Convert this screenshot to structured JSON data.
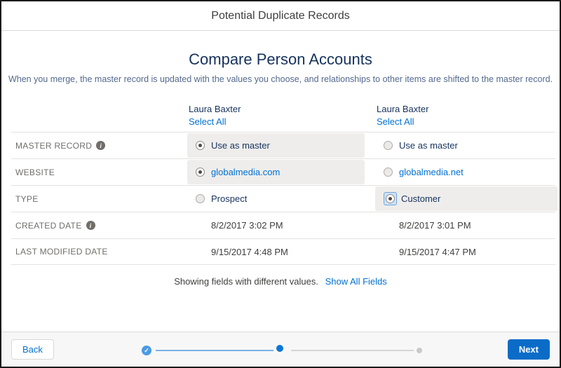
{
  "dialog": {
    "title": "Potential Duplicate Records"
  },
  "main": {
    "title": "Compare Person Accounts",
    "subtitle": "When you merge, the master record is updated with the values you choose, and relationships to other items are shifted to the master record.",
    "columns": [
      {
        "name": "Laura Baxter",
        "select_all": "Select All"
      },
      {
        "name": "Laura Baxter",
        "select_all": "Select All"
      }
    ],
    "rows": [
      {
        "label": "MASTER RECORD",
        "has_info_icon": true,
        "cells": [
          {
            "control": "radio",
            "checked": true,
            "highlighted": true,
            "text": "Use as master",
            "is_link": false
          },
          {
            "control": "radio",
            "checked": false,
            "highlighted": false,
            "text": "Use as master",
            "is_link": false
          }
        ]
      },
      {
        "label": "WEBSITE",
        "has_info_icon": false,
        "cells": [
          {
            "control": "radio",
            "checked": true,
            "highlighted": true,
            "text": "globalmedia.com",
            "is_link": true
          },
          {
            "control": "radio",
            "checked": false,
            "highlighted": false,
            "text": "globalmedia.net",
            "is_link": true
          }
        ]
      },
      {
        "label": "TYPE",
        "has_info_icon": false,
        "cells": [
          {
            "control": "radio",
            "checked": false,
            "highlighted": false,
            "text": "Prospect",
            "is_link": false
          },
          {
            "control": "radio",
            "checked": true,
            "highlighted": true,
            "focused": true,
            "text": "Customer",
            "is_link": false
          }
        ]
      },
      {
        "label": "CREATED DATE",
        "has_info_icon": true,
        "cells": [
          {
            "control": "text",
            "text": "8/2/2017 3:02 PM"
          },
          {
            "control": "text",
            "text": "8/2/2017 3:01 PM"
          }
        ]
      },
      {
        "label": "LAST MODIFIED DATE",
        "has_info_icon": false,
        "cells": [
          {
            "control": "text",
            "text": "9/15/2017 4:48 PM"
          },
          {
            "control": "text",
            "text": "9/15/2017 4:47 PM"
          }
        ]
      }
    ],
    "note": {
      "text": "Showing fields with different values.",
      "link_label": "Show All Fields"
    }
  },
  "footer": {
    "back_label": "Back",
    "next_label": "Next",
    "progress": {
      "steps": [
        "completed",
        "current",
        "upcoming"
      ]
    }
  },
  "icons": {
    "info": "i",
    "completed_check": "✓"
  },
  "colors": {
    "accent_blue": "#0070d2",
    "heading_navy": "#16325c",
    "subtitle_gray_blue": "#54698d",
    "highlight_gray": "#eeedec",
    "next_button_blue": "#0b6cc8"
  }
}
